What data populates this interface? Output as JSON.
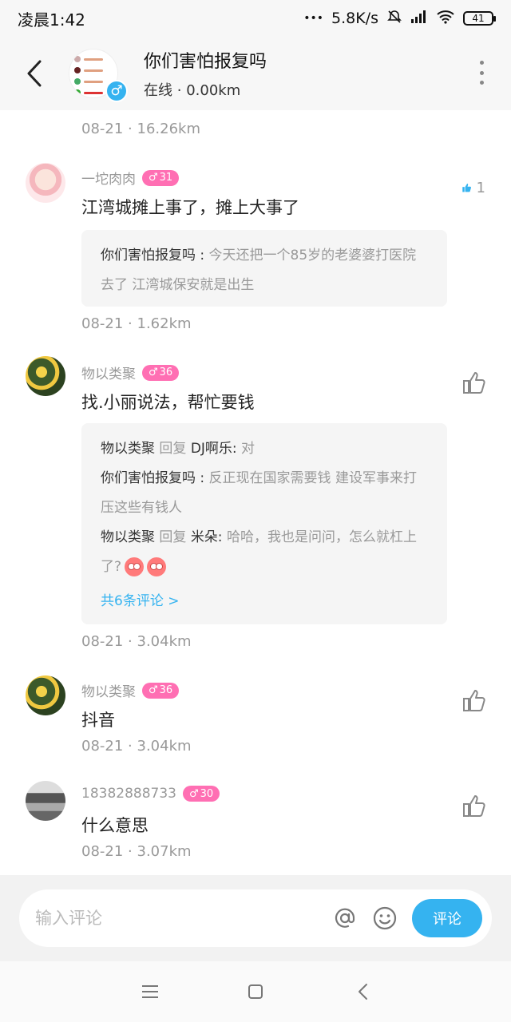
{
  "status_bar": {
    "time": "凌晨1:42",
    "network_speed": "5.8K/s",
    "battery": "41"
  },
  "header": {
    "title": "你们害怕报复吗",
    "status": "在线",
    "distance": "0.00km",
    "gender_symbol": "♂"
  },
  "top_meta": {
    "date": "08-21",
    "distance": "16.26km"
  },
  "comments": [
    {
      "name": "一坨肉肉",
      "level": "31",
      "text": "江湾城摊上事了，摊上大事了",
      "likes": "1",
      "liked": true,
      "replies": [
        {
          "name": "你们害怕报复吗 :",
          "text": " 今天还把一个85岁的老婆婆打医院去了 江湾城保安就是出生"
        }
      ],
      "date": "08-21",
      "distance": "1.62km"
    },
    {
      "name": "物以类聚",
      "level": "36",
      "text": "找.小丽说法，帮忙要钱",
      "liked": false,
      "replies": [
        {
          "name": "物以类聚",
          "reply_word": " 回复 ",
          "target": "DJ啊乐:",
          "text": " 对"
        },
        {
          "name": "你们害怕报复吗 :",
          "text": " 反正现在国家需要钱 建设军事来打压这些有钱人"
        },
        {
          "name": "物以类聚",
          "reply_word": " 回复 ",
          "target": "米朵:",
          "text": " 哈哈，我也是问问，怎么就杠上了?"
        }
      ],
      "more_link": "共6条评论 >",
      "date": "08-21",
      "distance": "3.04km"
    },
    {
      "name": "物以类聚",
      "level": "36",
      "text": "抖音",
      "liked": false,
      "date": "08-21",
      "distance": "3.04km"
    },
    {
      "name": "18382888733",
      "level": "30",
      "text": "什么意思",
      "liked": false,
      "date": "08-21",
      "distance": "3.07km"
    }
  ],
  "input": {
    "placeholder": "输入评论",
    "send_label": "评论"
  },
  "colors": {
    "accent": "#35b3f0",
    "level_badge": "#ff6fb3",
    "muted": "#999999"
  }
}
